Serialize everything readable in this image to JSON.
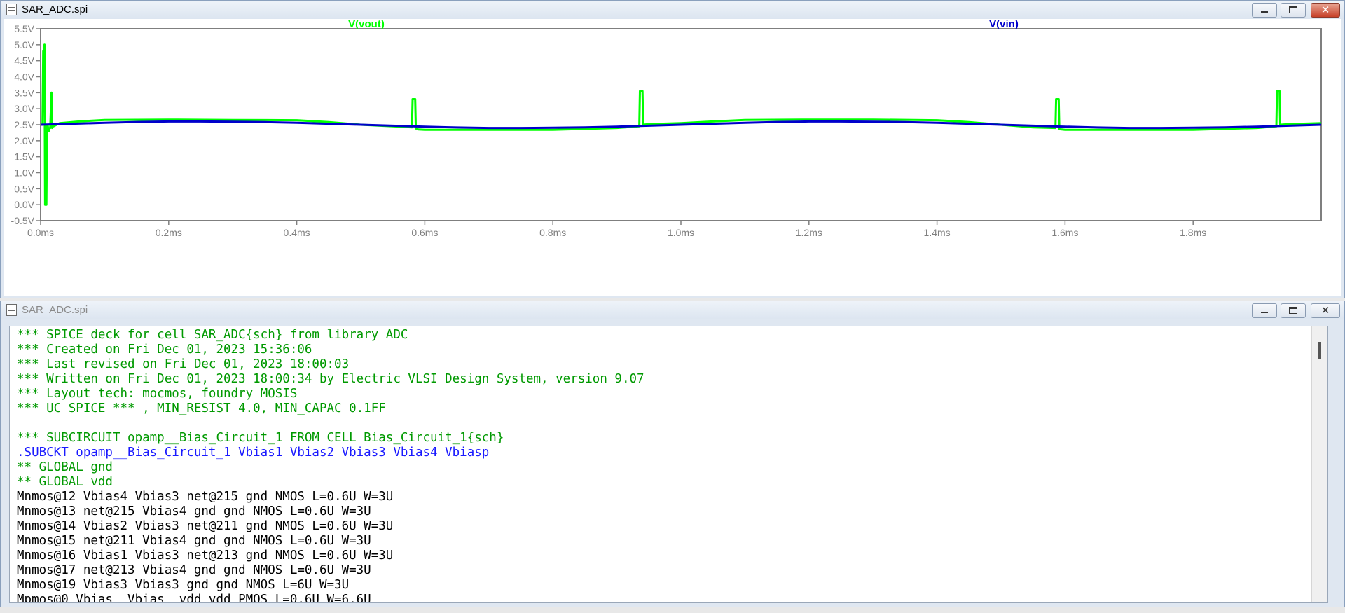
{
  "plot_window": {
    "title": "SAR_ADC.spi",
    "buttons": {
      "minimize": "minimize",
      "maximize": "maximize",
      "close": "close"
    }
  },
  "text_window": {
    "title": "SAR_ADC.spi",
    "lines": [
      {
        "kind": "comment",
        "text": "*** SPICE deck for cell SAR_ADC{sch} from library ADC"
      },
      {
        "kind": "comment",
        "text": "*** Created on Fri Dec 01, 2023 15:36:06"
      },
      {
        "kind": "comment",
        "text": "*** Last revised on Fri Dec 01, 2023 18:00:03"
      },
      {
        "kind": "comment",
        "text": "*** Written on Fri Dec 01, 2023 18:00:34 by Electric VLSI Design System, version 9.07"
      },
      {
        "kind": "comment",
        "text": "*** Layout tech: mocmos, foundry MOSIS"
      },
      {
        "kind": "comment",
        "text": "*** UC SPICE *** , MIN_RESIST 4.0, MIN_CAPAC 0.1FF"
      },
      {
        "kind": "blank",
        "text": ""
      },
      {
        "kind": "comment",
        "text": "*** SUBCIRCUIT opamp__Bias_Circuit_1 FROM CELL Bias_Circuit_1{sch}"
      },
      {
        "kind": "cmd",
        "text": ".SUBCKT opamp__Bias_Circuit_1 Vbias1 Vbias2 Vbias3 Vbias4 Vbiasp"
      },
      {
        "kind": "comment",
        "text": "** GLOBAL gnd"
      },
      {
        "kind": "comment",
        "text": "** GLOBAL vdd"
      },
      {
        "kind": "plain",
        "text": "Mnmos@12 Vbias4 Vbias3 net@215 gnd NMOS L=0.6U W=3U"
      },
      {
        "kind": "plain",
        "text": "Mnmos@13 net@215 Vbias4 gnd gnd NMOS L=0.6U W=3U"
      },
      {
        "kind": "plain",
        "text": "Mnmos@14 Vbias2 Vbias3 net@211 gnd NMOS L=0.6U W=3U"
      },
      {
        "kind": "plain",
        "text": "Mnmos@15 net@211 Vbias4 gnd gnd NMOS L=0.6U W=3U"
      },
      {
        "kind": "plain",
        "text": "Mnmos@16 Vbias1 Vbias3 net@213 gnd NMOS L=0.6U W=3U"
      },
      {
        "kind": "plain",
        "text": "Mnmos@17 net@213 Vbias4 gnd gnd NMOS L=0.6U W=3U"
      },
      {
        "kind": "plain",
        "text": "Mnmos@19 Vbias3 Vbias3 gnd gnd NMOS L=6U W=3U"
      },
      {
        "kind": "plain",
        "text": "Mpmos@0 Vbias  Vbias  vdd vdd PMOS L=0.6U W=6.6U"
      }
    ]
  },
  "chart_data": {
    "type": "line",
    "title": "",
    "xlabel": "",
    "ylabel": "",
    "xlim": [
      0,
      2.0
    ],
    "ylim": [
      -0.5,
      5.5
    ],
    "x_ticks": [
      "0.0ms",
      "0.2ms",
      "0.4ms",
      "0.6ms",
      "0.8ms",
      "1.0ms",
      "1.2ms",
      "1.4ms",
      "1.6ms",
      "1.8ms"
    ],
    "x_tick_values": [
      0,
      0.2,
      0.4,
      0.6,
      0.8,
      1.0,
      1.2,
      1.4,
      1.6,
      1.8
    ],
    "y_ticks": [
      "5.5V",
      "5.0V",
      "4.5V",
      "4.0V",
      "3.5V",
      "3.0V",
      "2.5V",
      "2.0V",
      "1.5V",
      "1.0V",
      "0.5V",
      "0.0V",
      "-0.5V"
    ],
    "y_tick_values": [
      5.5,
      5.0,
      4.5,
      4.0,
      3.5,
      3.0,
      2.5,
      2.0,
      1.5,
      1.0,
      0.5,
      0.0,
      -0.5
    ],
    "grid": false,
    "x_unit": "ms",
    "series": [
      {
        "name": "V(vout)",
        "color": "#00ff00",
        "x": [
          0,
          0.003,
          0.004,
          0.005,
          0.006,
          0.007,
          0.008,
          0.009,
          0.01,
          0.011,
          0.012,
          0.013,
          0.014,
          0.015,
          0.017,
          0.018,
          0.019,
          0.02,
          0.03,
          0.06,
          0.1,
          0.2,
          0.3,
          0.4,
          0.45,
          0.5,
          0.55,
          0.58,
          0.581,
          0.585,
          0.586,
          0.59,
          0.6,
          0.7,
          0.8,
          0.9,
          0.935,
          0.936,
          0.94,
          0.941,
          0.95,
          1.0,
          1.05,
          1.1,
          1.2,
          1.3,
          1.4,
          1.45,
          1.5,
          1.55,
          1.585,
          1.586,
          1.59,
          1.591,
          1.6,
          1.7,
          1.8,
          1.9,
          1.93,
          1.931,
          1.935,
          1.936,
          1.95,
          2.0
        ],
        "y": [
          2.5,
          2.5,
          4.8,
          4.8,
          5.0,
          0.0,
          0.0,
          0.0,
          2.5,
          2.5,
          2.3,
          2.3,
          2.4,
          2.4,
          3.5,
          2.4,
          2.45,
          2.45,
          2.55,
          2.6,
          2.65,
          2.66,
          2.65,
          2.64,
          2.58,
          2.5,
          2.45,
          2.42,
          3.3,
          3.3,
          2.38,
          2.35,
          2.34,
          2.34,
          2.34,
          2.4,
          2.45,
          3.55,
          3.55,
          2.5,
          2.52,
          2.55,
          2.6,
          2.65,
          2.66,
          2.66,
          2.64,
          2.58,
          2.5,
          2.42,
          2.4,
          3.3,
          3.3,
          2.36,
          2.34,
          2.34,
          2.34,
          2.4,
          2.45,
          3.55,
          3.55,
          2.5,
          2.52,
          2.55
        ]
      },
      {
        "name": "V(vin)",
        "color": "#0000cc",
        "x": [
          0,
          0.05,
          0.1,
          0.15,
          0.2,
          0.25,
          0.3,
          0.35,
          0.4,
          0.45,
          0.5,
          0.55,
          0.6,
          0.65,
          0.7,
          0.75,
          0.8,
          0.85,
          0.9,
          0.95,
          1.0,
          1.05,
          1.1,
          1.15,
          1.2,
          1.25,
          1.3,
          1.35,
          1.4,
          1.45,
          1.5,
          1.55,
          1.6,
          1.65,
          1.7,
          1.75,
          1.8,
          1.85,
          1.9,
          1.95,
          2.0
        ],
        "y": [
          2.5,
          2.53,
          2.56,
          2.585,
          2.6,
          2.6,
          2.595,
          2.58,
          2.56,
          2.53,
          2.5,
          2.47,
          2.44,
          2.415,
          2.4,
          2.4,
          2.405,
          2.42,
          2.44,
          2.47,
          2.5,
          2.53,
          2.56,
          2.585,
          2.6,
          2.6,
          2.595,
          2.58,
          2.56,
          2.53,
          2.5,
          2.47,
          2.44,
          2.415,
          2.4,
          2.4,
          2.405,
          2.42,
          2.44,
          2.47,
          2.5
        ]
      }
    ]
  }
}
